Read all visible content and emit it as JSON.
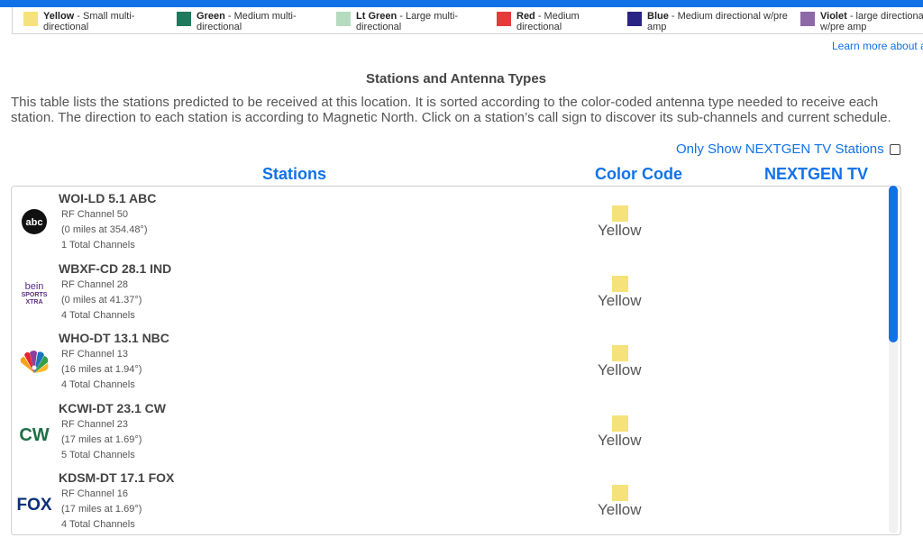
{
  "legend": {
    "items": [
      {
        "name": "Yellow",
        "desc": " - Small multi-directional",
        "color": "#f6e27a"
      },
      {
        "name": "Green",
        "desc": " - Medium multi-directional",
        "color": "#1d7a5c"
      },
      {
        "name": "Lt Green",
        "desc": " - Large multi-directional",
        "color": "#b5dbbf"
      },
      {
        "name": "Red",
        "desc": " - Medium directional",
        "color": "#e53b3b"
      },
      {
        "name": "Blue",
        "desc": " - Medium directional w/pre amp",
        "color": "#2a2386"
      },
      {
        "name": "Violet",
        "desc": " - large directional w/pre amp",
        "color": "#8e69a8"
      }
    ],
    "learn_more": "Learn more about an"
  },
  "section": {
    "title": "Stations and Antenna Types",
    "description": "This table lists the stations predicted to be received at this location. It is sorted according to the color-coded antenna type needed to receive each station. The direction to each station is according to Magnetic North. Click on a station’s call sign to discover its sub-channels and current schedule."
  },
  "filter": {
    "nextgen_label": "Only Show NEXTGEN TV Stations",
    "checked": false
  },
  "columns": {
    "stations": "Stations",
    "color_code": "Color Code",
    "nextgen": "NEXTGEN TV"
  },
  "stations": [
    {
      "call": "WOI-LD 5.1 ABC",
      "rf": "RF Channel 50",
      "distance": "(0 miles at 354.48°)",
      "channels": "1 Total Channels",
      "color_name": "Yellow",
      "color": "#f6e27a",
      "logo": "abc-logo"
    },
    {
      "call": "WBXF-CD 28.1 IND",
      "rf": "RF Channel 28",
      "distance": "(0 miles at 41.37°)",
      "channels": "4 Total Channels",
      "color_name": "Yellow",
      "color": "#f6e27a",
      "logo": "bein-sports-xtra-logo",
      "logo_text": [
        "bein",
        "SPORTS",
        "XTRA"
      ]
    },
    {
      "call": "WHO-DT 13.1 NBC",
      "rf": "RF Channel 13",
      "distance": "(16 miles at 1.94°)",
      "channels": "4 Total Channels",
      "color_name": "Yellow",
      "color": "#f6e27a",
      "logo": "nbc-peacock-logo"
    },
    {
      "call": "KCWI-DT 23.1 CW",
      "rf": "RF Channel 23",
      "distance": "(17 miles at 1.69°)",
      "channels": "5 Total Channels",
      "color_name": "Yellow",
      "color": "#f6e27a",
      "logo": "cw-logo",
      "logo_text": "CW"
    },
    {
      "call": "KDSM-DT 17.1 FOX",
      "rf": "RF Channel 16",
      "distance": "(17 miles at 1.69°)",
      "channels": "4 Total Channels",
      "color_name": "Yellow",
      "color": "#f6e27a",
      "logo": "fox-logo",
      "logo_text": "FOX"
    }
  ],
  "scroll": {
    "position": 0.0,
    "visible_fraction": 0.45
  }
}
